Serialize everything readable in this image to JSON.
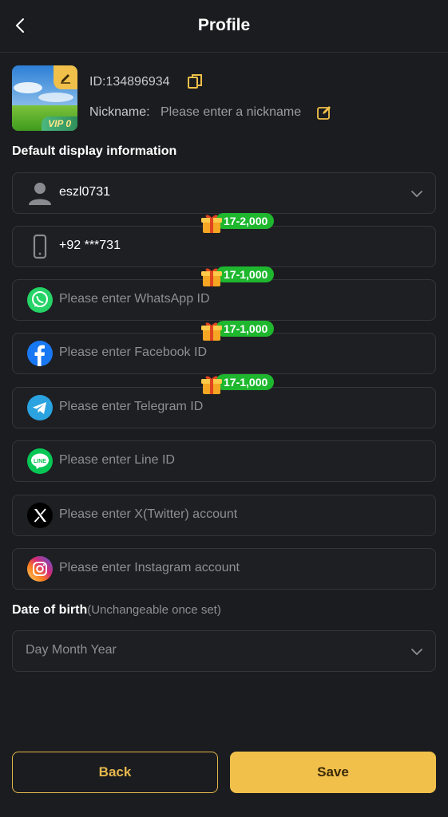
{
  "header": {
    "title": "Profile"
  },
  "profile": {
    "id_text": "ID:134896934",
    "nickname_label": "Nickname:",
    "nickname_placeholder": "Please enter a nickname",
    "vip_label": "VIP 0"
  },
  "display_section": {
    "label": "Default display information"
  },
  "fields": {
    "username": {
      "value": "eszl0731"
    },
    "phone": {
      "value": "+92 ***731",
      "reward": "17-2,000"
    },
    "whatsapp": {
      "placeholder": "Please enter WhatsApp ID",
      "reward": "17-1,000"
    },
    "facebook": {
      "placeholder": "Please enter Facebook ID",
      "reward": "17-1,000"
    },
    "telegram": {
      "placeholder": "Please enter Telegram ID",
      "reward": "17-1,000"
    },
    "line": {
      "placeholder": "Please enter Line ID",
      "icon_text": "LINE"
    },
    "twitter": {
      "placeholder": "Please enter X(Twitter) account"
    },
    "instagram": {
      "placeholder": "Please enter Instagram account"
    }
  },
  "dob": {
    "label": "Date of birth",
    "note": "(Unchangeable once set)",
    "placeholder": "Day Month Year"
  },
  "buttons": {
    "back": "Back",
    "save": "Save"
  },
  "colors": {
    "background": "#1b1c1f",
    "accent_gold": "#f1c04a",
    "reward_green": "#1eb72e",
    "field_border": "#34363b"
  }
}
